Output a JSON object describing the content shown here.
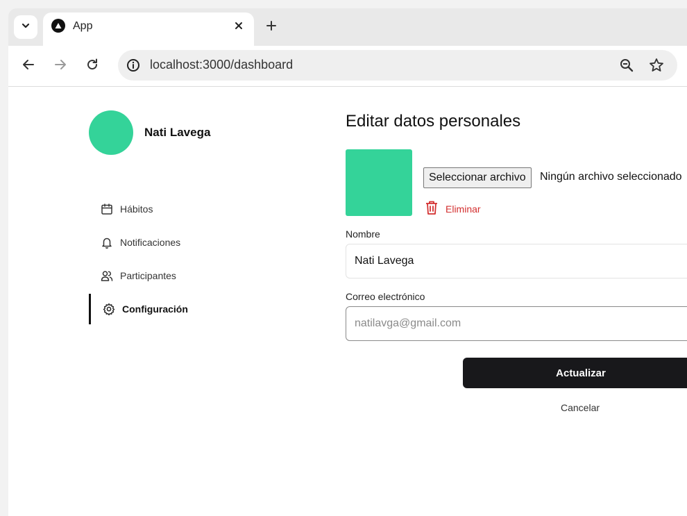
{
  "browser": {
    "tab_title": "App",
    "url": "localhost:3000/dashboard"
  },
  "sidebar": {
    "user_name": "Nati Lavega",
    "avatar_color": "#34d399",
    "items": [
      {
        "label": "Hábitos",
        "icon": "calendar-icon",
        "active": false
      },
      {
        "label": "Notificaciones",
        "icon": "bell-icon",
        "active": false
      },
      {
        "label": "Participantes",
        "icon": "users-icon",
        "active": false
      },
      {
        "label": "Configuración",
        "icon": "gear-icon",
        "active": true
      }
    ]
  },
  "main": {
    "title": "Editar datos personales",
    "photo_color": "#34d399",
    "file_button_label": "Seleccionar archivo",
    "file_status": "Ningún archivo seleccionado",
    "delete_label": "Eliminar",
    "delete_color": "#d32f2f",
    "name_label": "Nombre",
    "name_value": "Nati Lavega",
    "email_label": "Correo electrónico",
    "email_placeholder": "natilavga@gmail.com",
    "submit_label": "Actualizar",
    "cancel_label": "Cancelar"
  }
}
